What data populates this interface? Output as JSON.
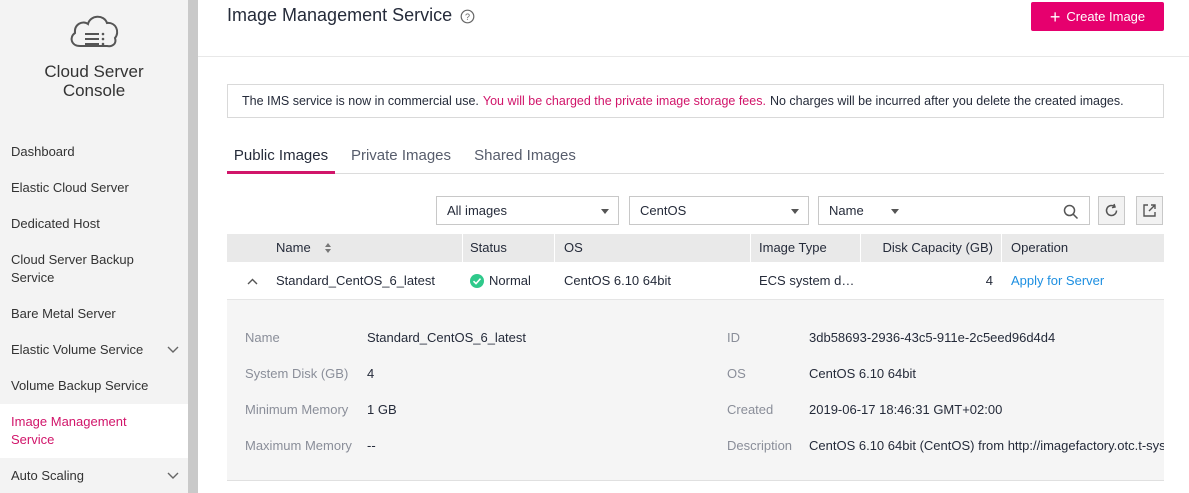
{
  "sidebar": {
    "title_line1": "Cloud Server",
    "title_line2": "Console",
    "items": [
      {
        "label": "Dashboard"
      },
      {
        "label": "Elastic Cloud Server"
      },
      {
        "label": "Dedicated Host"
      },
      {
        "label": "Cloud Server Backup Service"
      },
      {
        "label": "Bare Metal Server"
      },
      {
        "label": "Elastic Volume Service"
      },
      {
        "label": "Volume Backup Service"
      },
      {
        "label": "Image Management Service"
      },
      {
        "label": "Auto Scaling"
      }
    ]
  },
  "header": {
    "title": "Image Management Service",
    "create_label": "Create Image"
  },
  "notice": {
    "text_before": "The IMS service is now in commercial use.",
    "text_highlight": "You will be charged the private image storage fees.",
    "text_after": "No charges will be incurred after you delete the created images."
  },
  "tabs": [
    {
      "label": "Public Images"
    },
    {
      "label": "Private Images"
    },
    {
      "label": "Shared Images"
    }
  ],
  "filters": {
    "scope": "All images",
    "os": "CentOS",
    "field": "Name"
  },
  "table": {
    "columns": [
      "Name",
      "Status",
      "OS",
      "Image Type",
      "Disk Capacity (GB)",
      "Operation"
    ],
    "row": {
      "name": "Standard_CentOS_6_latest",
      "status": "Normal",
      "os": "CentOS 6.10 64bit",
      "image_type": "ECS system d…",
      "disk_capacity": "4",
      "operation": "Apply for Server"
    }
  },
  "details": {
    "name_label": "Name",
    "name_value": "Standard_CentOS_6_latest",
    "system_disk_label": "System Disk (GB)",
    "system_disk_value": "4",
    "min_memory_label": "Minimum Memory",
    "min_memory_value": "1 GB",
    "max_memory_label": "Maximum Memory",
    "max_memory_value": "--",
    "id_label": "ID",
    "id_value": "3db58693-2936-43c5-911e-2c5eed96d4d4",
    "os_label": "OS",
    "os_value": "CentOS 6.10 64bit",
    "created_label": "Created",
    "created_value": "2019-06-17 18:46:31 GMT+02:00",
    "description_label": "Description",
    "description_value": "CentOS 6.10 64bit (CentOS) from http://imagefactory.otc.t-sys…"
  },
  "colors": {
    "accent": "#e6006e",
    "link": "#1d8fe1",
    "status_ok": "#2fc98b"
  }
}
